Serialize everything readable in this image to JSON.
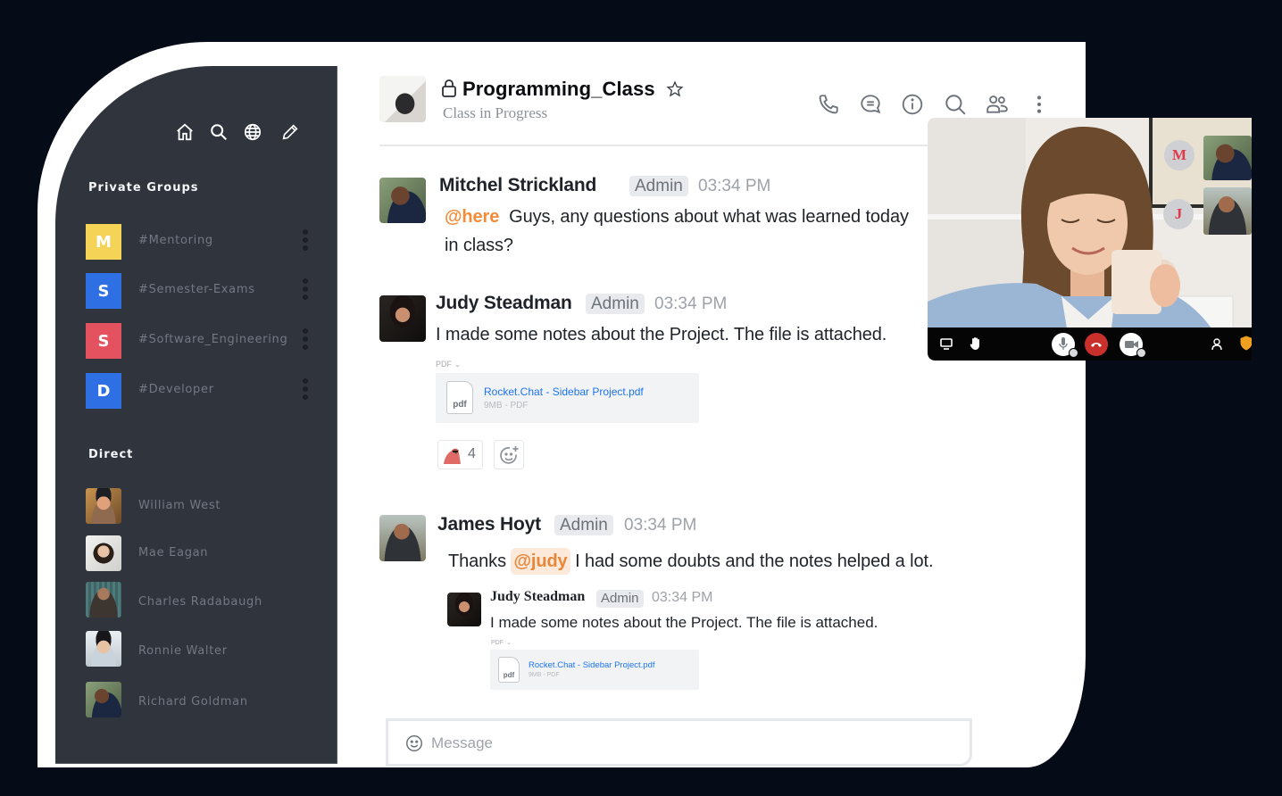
{
  "sidebar": {
    "toolbar_icons": [
      "home-icon",
      "search-icon",
      "globe-icon",
      "pencil-icon"
    ],
    "private_groups_label": "Private Groups",
    "groups": [
      {
        "initial": "M",
        "name": "#Mentoring",
        "color": "#f5d357"
      },
      {
        "initial": "S",
        "name": "#Semester-Exams",
        "color": "#2f6fe4"
      },
      {
        "initial": "S",
        "name": "#Software_Engineering",
        "color": "#e5525f"
      },
      {
        "initial": "D",
        "name": "#Developer",
        "color": "#2f6fe4"
      }
    ],
    "direct_label": "Direct",
    "direct": [
      {
        "name": "William West"
      },
      {
        "name": "Mae Eagan"
      },
      {
        "name": "Charles Radabaugh"
      },
      {
        "name": "Ronnie Walter"
      },
      {
        "name": "Richard Goldman"
      }
    ]
  },
  "room": {
    "title": "Programming_Class",
    "subtitle": "Class in Progress",
    "header_icons": [
      "phone-icon",
      "discussion-icon",
      "info-icon",
      "search-icon",
      "members-icon",
      "kebab-menu-icon"
    ]
  },
  "messages": [
    {
      "author": "Mitchel Strickland",
      "role": "Admin",
      "time": "03:34 PM",
      "mention": "@here",
      "text": "Guys, any questions about what was learned today in class?"
    },
    {
      "author": "Judy Steadman",
      "role": "Admin",
      "time": "03:34 PM",
      "text": "I made some notes about the Project. The file is attached.",
      "attachment": {
        "type_label": "PDF",
        "icon_label": "pdf",
        "name": "Rocket.Chat - Sidebar Project.pdf",
        "meta": "9MB - PDF"
      },
      "reactions": [
        {
          "emoji": "parrot",
          "count": "4"
        }
      ]
    },
    {
      "author": "James Hoyt",
      "role": "Admin",
      "time": "03:34 PM",
      "text_before": "Thanks",
      "mention": "@judy",
      "text_after": "I had some doubts and the notes helped a lot.",
      "quote": {
        "author": "Judy Steadman",
        "role": "Admin",
        "time": "03:34 PM",
        "text": "I made some notes about the Project. The file is attached.",
        "attachment": {
          "type_label": "PDF",
          "icon_label": "pdf",
          "name": "Rocket.Chat - Sidebar Project.pdf",
          "meta": "9MB - PDF"
        }
      }
    }
  ],
  "composer": {
    "placeholder": "Message"
  },
  "video_call": {
    "participants": [
      {
        "initial": "M"
      },
      {
        "initial": "J"
      }
    ],
    "controls": [
      "screen-share-icon",
      "raise-hand-icon",
      "microphone-icon",
      "hang-up-icon",
      "camera-icon",
      "participants-icon",
      "security-shield-icon"
    ]
  },
  "colors": {
    "background": "#050b17",
    "sidebar": "#2f343d",
    "mention": "#f38c39",
    "link": "#1d74f5",
    "hang_up": "#c9302c"
  }
}
